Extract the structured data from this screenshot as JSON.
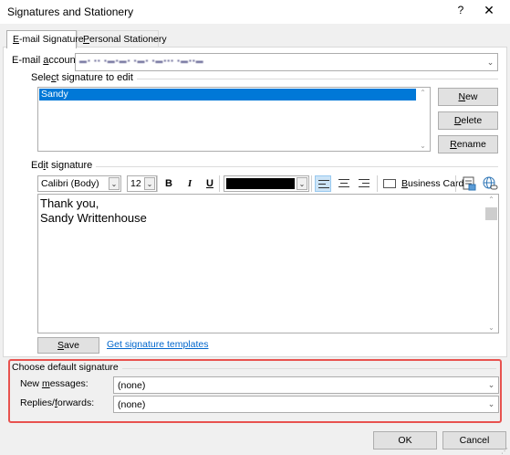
{
  "window": {
    "title": "Signatures and Stationery",
    "help": "?",
    "close": "✕"
  },
  "tabs": [
    {
      "pre": "",
      "key": "E",
      "post": "-mail Signature"
    },
    {
      "pre": "",
      "key": "P",
      "post": "ersonal Stationery"
    }
  ],
  "email_account": {
    "label_pre": "E-mail ",
    "label_key": "a",
    "label_post": "ccount:",
    "value": "▬▪ ▪▪ ▪▬▪▬▪ ▪▬▪ ▪▬▪▪▪ ▪▬▪▪▬"
  },
  "select_signature": {
    "label_pre": "Sele",
    "label_key": "c",
    "label_post": "t signature to edit",
    "items": [
      "Sandy"
    ]
  },
  "buttons": {
    "new": {
      "key": "N",
      "post": "ew"
    },
    "delete": {
      "key": "D",
      "post": "elete"
    },
    "rename": {
      "key": "R",
      "post": "ename"
    },
    "save": {
      "key": "S",
      "post": "ave"
    },
    "ok": "OK",
    "cancel": "Cancel"
  },
  "edit_signature": {
    "label_pre": "Ed",
    "label_key": "i",
    "label_post": "t signature",
    "font": "Calibri (Body)",
    "size": "12",
    "bold": "B",
    "italic": "I",
    "underline": "U",
    "font_color": "#000000",
    "business_card": {
      "key": "B",
      "post": "usiness Card"
    },
    "text_lines": [
      "Thank you,",
      "Sandy Writtenhouse"
    ]
  },
  "templates_link": "Get signature templates",
  "default_signature": {
    "label": "Choose default signature",
    "new_messages": {
      "pre": "New ",
      "key": "m",
      "post": "essages:",
      "value": "(none)"
    },
    "replies": {
      "pre": "Replies/",
      "key": "f",
      "post": "orwards:",
      "value": "(none)"
    }
  },
  "colors": {
    "selection": "#0078d7",
    "highlight_border": "#e8524f",
    "link": "#0066cc"
  }
}
